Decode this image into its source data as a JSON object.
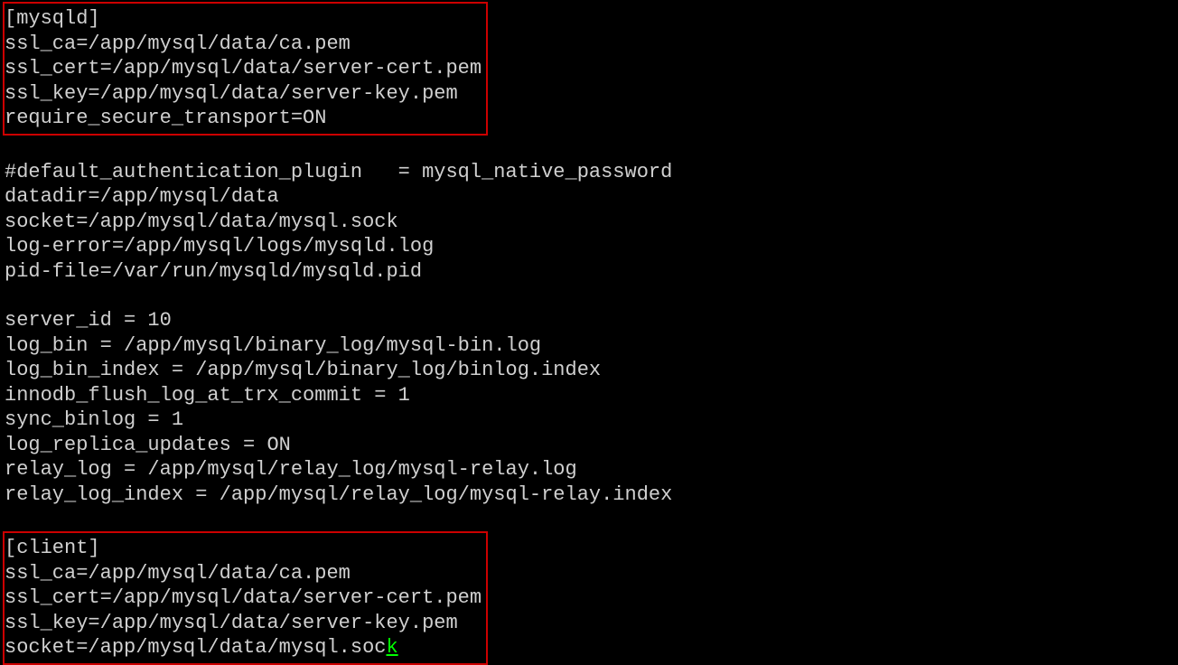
{
  "block_mysqld": {
    "l1": "[mysqld]",
    "l2": "ssl_ca=/app/mysql/data/ca.pem",
    "l3": "ssl_cert=/app/mysql/data/server-cert.pem",
    "l4": "ssl_key=/app/mysql/data/server-key.pem",
    "l5": "require_secure_transport=ON"
  },
  "middle": {
    "l1": "#default_authentication_plugin   = mysql_native_password",
    "l2": "datadir=/app/mysql/data",
    "l3": "socket=/app/mysql/data/mysql.sock",
    "l4": "log-error=/app/mysql/logs/mysqld.log",
    "l5": "pid-file=/var/run/mysqld/mysqld.pid",
    "l6": "server_id = 10",
    "l7": "log_bin = /app/mysql/binary_log/mysql-bin.log",
    "l8": "log_bin_index = /app/mysql/binary_log/binlog.index",
    "l9": "innodb_flush_log_at_trx_commit = 1",
    "l10": "sync_binlog = 1",
    "l11": "log_replica_updates = ON",
    "l12": "relay_log = /app/mysql/relay_log/mysql-relay.log",
    "l13": "relay_log_index = /app/mysql/relay_log/mysql-relay.index"
  },
  "block_client": {
    "l1": "[client]",
    "l2": "ssl_ca=/app/mysql/data/ca.pem",
    "l3": "ssl_cert=/app/mysql/data/server-cert.pem",
    "l4": "ssl_key=/app/mysql/data/server-key.pem",
    "l5_prefix": "socket=/app/mysql/data/mysql.soc",
    "l5_cursor": "k"
  }
}
